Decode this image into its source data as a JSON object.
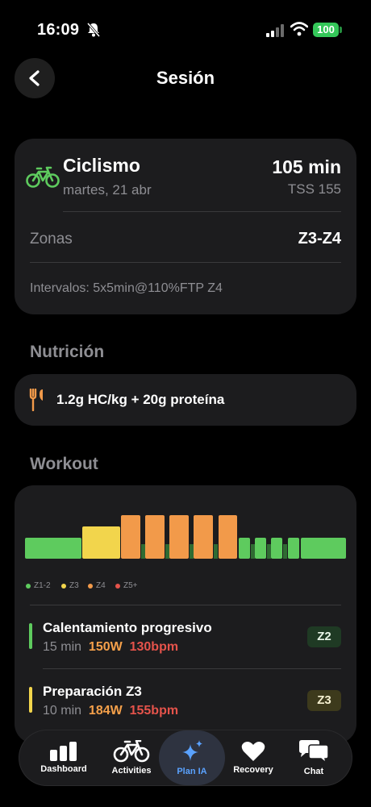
{
  "status_bar": {
    "time": "16:09",
    "battery": "100"
  },
  "header": {
    "title": "Sesión"
  },
  "session": {
    "sport": "Ciclismo",
    "date": "martes, 21 abr",
    "duration": "105 min",
    "tss": "TSS 155",
    "zones_label": "Zonas",
    "zones_value": "Z3-Z4",
    "intervals": "Intervalos: 5x5min@110%FTP Z4"
  },
  "nutrition": {
    "title": "Nutrición",
    "text": "1.2g HC/kg + 20g proteína"
  },
  "workout": {
    "title": "Workout",
    "legend": [
      "Z1-2",
      "Z3",
      "Z4",
      "Z5+"
    ],
    "colors": {
      "z12": "#5ecb5e",
      "z3": "#f2d54c",
      "z4": "#f29a4a",
      "z5": "#e5534b"
    },
    "steps": [
      {
        "name": "Calentamiento progresivo",
        "duration": "15 min",
        "watts": "150W",
        "bpm": "130bpm",
        "zone": "Z2"
      },
      {
        "name": "Preparación Z3",
        "duration": "10 min",
        "watts": "184W",
        "bpm": "155bpm",
        "zone": "Z3"
      }
    ]
  },
  "tabs": [
    {
      "label": "Dashboard",
      "icon": "bar-chart-icon"
    },
    {
      "label": "Activities",
      "icon": "bicycle-icon"
    },
    {
      "label": "Plan IA",
      "icon": "sparkles-icon",
      "active": true
    },
    {
      "label": "Recovery",
      "icon": "heart-icon"
    },
    {
      "label": "Chat",
      "icon": "chat-bubbles-icon"
    }
  ]
}
